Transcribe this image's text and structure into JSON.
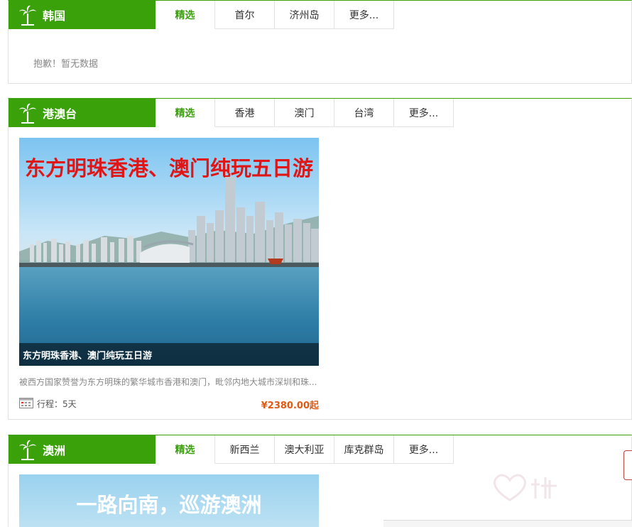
{
  "colors": {
    "accent": "#3aa10a",
    "price": "#e05a12",
    "headline_red": "#e01515"
  },
  "sections": [
    {
      "title": "韩国",
      "icon": "palm-tree-icon",
      "tabs": [
        "精选",
        "首尔",
        "济州岛",
        "更多..."
      ],
      "empty_message": "抱歉！暂无数据"
    },
    {
      "title": "港澳台",
      "icon": "palm-tree-icon",
      "tabs": [
        "精选",
        "香港",
        "澳门",
        "台湾",
        "更多..."
      ],
      "card": {
        "image_headline": "东方明珠香港、澳门纯玩五日游",
        "image_caption": "东方明珠香港、澳门纯玩五日游",
        "description": "被西方国家赞誉为东方明珠的繁华城市香港和澳门，毗邻内地大城市深圳和珠...",
        "duration": "行程：5天",
        "price": "¥2380.00起"
      }
    },
    {
      "title": "澳洲",
      "icon": "palm-tree-icon",
      "tabs": [
        "精选",
        "新西兰",
        "澳大利亚",
        "库克群岛",
        "更多..."
      ],
      "card": {
        "image_headline": "一路向南，巡游澳洲"
      }
    }
  ]
}
